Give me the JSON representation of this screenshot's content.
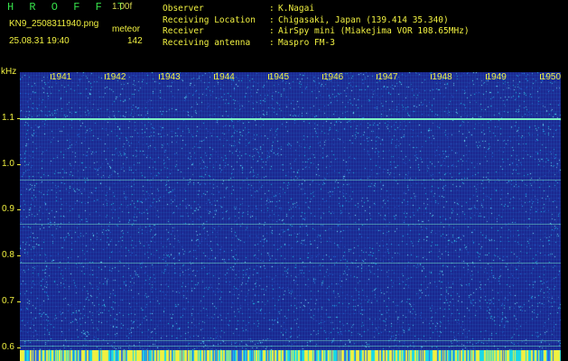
{
  "header": {
    "app_title": "H R O F F T",
    "version": "1.00f",
    "filename": "KN9_2508311940.png",
    "station": "meteor",
    "datetime": "25.08.31 19:40",
    "count": "142"
  },
  "info": [
    {
      "label": "Observer",
      "sep": ":",
      "value": "K.Nagai"
    },
    {
      "label": "Receiving Location",
      "sep": ":",
      "value": "Chigasaki, Japan (139.414 35.340)"
    },
    {
      "label": "Receiver",
      "sep": ":",
      "value": "AirSpy mini (Miakejima VOR 108.65MHz)"
    },
    {
      "label": "Receiving antenna",
      "sep": ":",
      "value": "Maspro FM-3"
    }
  ],
  "spectrogram": {
    "unit_label": "kHz",
    "x_ticks": [
      "1941",
      "1942",
      "1943",
      "1944",
      "1945",
      "1946",
      "1947",
      "1948",
      "1949",
      "1950"
    ],
    "y_ticks": [
      "1.1",
      "1.0",
      "0.9",
      "0.8",
      "0.7",
      "0.6"
    ],
    "y_range": [
      0.57,
      1.2
    ],
    "signal_lines_khz": [
      1.1,
      0.965,
      0.87,
      0.785,
      0.615,
      0.603
    ],
    "colors": {
      "background": "#1a2a8a",
      "noise": "#19c8e6",
      "signal": "#7ef0c0",
      "label": "#f0f040",
      "title": "#36e04a"
    }
  }
}
